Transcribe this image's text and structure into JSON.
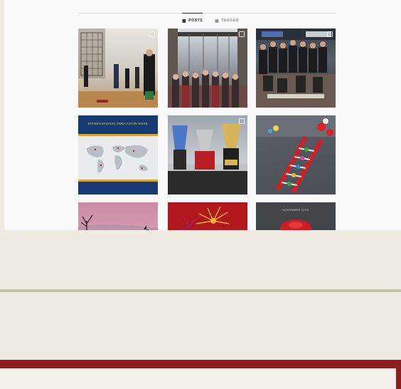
{
  "instagram_embed": {
    "tabs": [
      {
        "label": "POSTS",
        "icon": "grid-icon",
        "active": true
      },
      {
        "label": "TAGGED",
        "icon": "tag-icon",
        "active": false
      }
    ],
    "posts": [
      {
        "icon": "photo"
      },
      {
        "icon": "photo"
      },
      {
        "icon": "photo"
      },
      {
        "icon": "photo",
        "text": "INTERNATIONAL EDUCATION WEEK"
      },
      {
        "icon": "photo"
      },
      {
        "icon": "photo"
      },
      {
        "icon": "photo"
      },
      {
        "icon": "photo"
      },
      {
        "icon": "photo",
        "text": "NOVEMBER 11TH"
      }
    ]
  },
  "colors": {
    "page_background": "#efebe2",
    "embed_background": "#fafafa",
    "separator": "#c9c3b4",
    "footer_accent": "#8b1e22"
  }
}
